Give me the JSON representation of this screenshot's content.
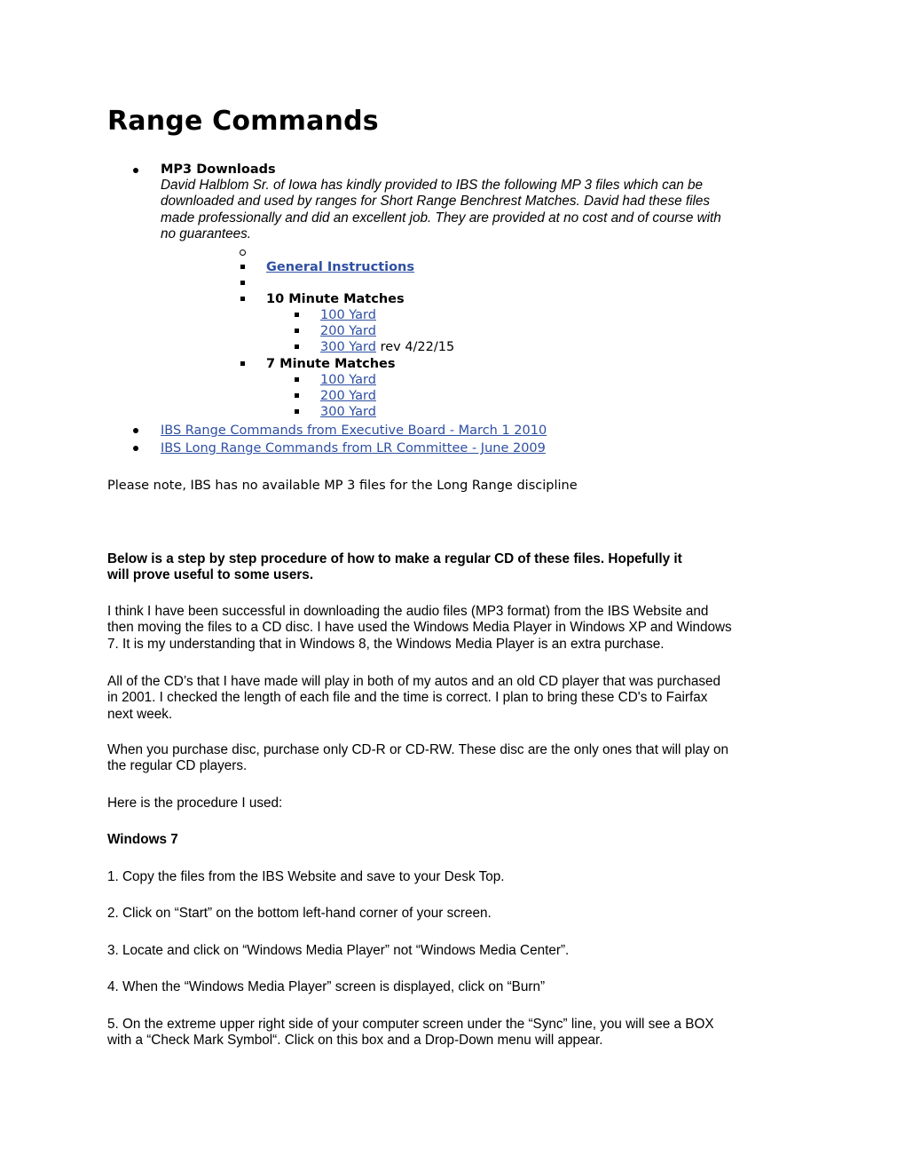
{
  "title": "Range Commands",
  "mp3": {
    "heading": "MP3 Downloads",
    "description_lines": [
      "David Halblom Sr. of Iowa has kindly provided to IBS the following MP 3 files which can be",
      "downloaded and used by ranges for Short Range Benchrest Matches. David had these files",
      "made professionally and did an excellent job. They are provided at no cost and of course with",
      "no guarantees."
    ],
    "general_instructions": "General Instructions",
    "ten_minute": {
      "heading": "10 Minute Matches",
      "items": [
        {
          "label": "100 Yard",
          "note": ""
        },
        {
          "label": "200 Yard",
          "note": ""
        },
        {
          "label": "300 Yard",
          "note": "rev 4/22/15"
        }
      ]
    },
    "seven_minute": {
      "heading": "7 Minute Matches",
      "items": [
        {
          "label": "100 Yard"
        },
        {
          "label": "200 Yard"
        },
        {
          "label": "300 Yard"
        }
      ]
    }
  },
  "links": [
    "IBS Range Commands from Executive Board - March 1 2010",
    "IBS Long Range Commands from LR Committee - June 2009"
  ],
  "note": "Please note, IBS has no available MP 3 files for the Long Range discipline",
  "procedure_intro_lines": [
    "Below is a step by step procedure of how to make a regular CD of these files. Hopefully it",
    "will prove useful to some users."
  ],
  "paragraphs": [
    [
      "I think I have been successful in downloading the audio files (MP3 format) from the IBS Website and",
      "then moving the files to a CD disc. I have used the Windows Media Player in Windows XP and Windows",
      "7. It is my understanding that in Windows 8, the Windows Media Player is an extra purchase."
    ],
    [
      "All of the CD’s that I have made will play in both of my autos and an old CD player that was purchased",
      "in 2001. I checked the length of each file and the time is correct. I plan to bring these CD's to Fairfax",
      "next week."
    ],
    [
      "When you purchase disc, purchase only CD-R or CD-RW. These disc are the only ones that will play on",
      "the regular CD players."
    ],
    [
      "Here is the procedure I used:"
    ]
  ],
  "windows7_heading": "Windows 7",
  "steps": [
    [
      "1. Copy the files from the IBS Website and save to your Desk Top."
    ],
    [
      "2. Click on “Start” on the bottom left-hand corner of your screen."
    ],
    [
      "3. Locate and click on “Windows Media Player” not “Windows Media Center”."
    ],
    [
      "4. When the “Windows Media Player” screen is displayed, click on “Burn”"
    ],
    [
      "5. On the extreme upper right side of your computer screen under the “Sync” line, you will see a BOX",
      "with a “Check Mark Symbol“. Click on this box and a Drop-Down menu will appear."
    ]
  ],
  "colors": {
    "link": "#2e4fa3",
    "text": "#000000"
  }
}
